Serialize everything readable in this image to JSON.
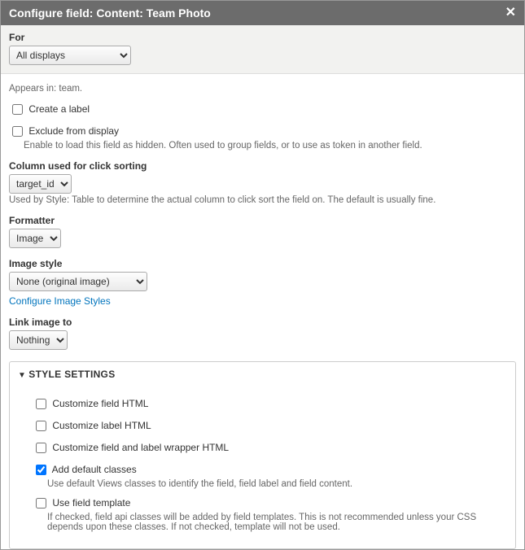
{
  "header": {
    "title": "Configure field: Content: Team Photo"
  },
  "for": {
    "label": "For",
    "value": "All displays"
  },
  "appears_in": "Appears in: team.",
  "create_label": {
    "label": "Create a label",
    "checked": false
  },
  "exclude": {
    "label": "Exclude from display",
    "checked": false,
    "help": "Enable to load this field as hidden. Often used to group fields, or to use as token in another field."
  },
  "click_sort": {
    "label": "Column used for click sorting",
    "value": "target_id",
    "help": "Used by Style: Table to determine the actual column to click sort the field on. The default is usually fine."
  },
  "formatter": {
    "label": "Formatter",
    "value": "Image"
  },
  "image_style": {
    "label": "Image style",
    "value": "None (original image)",
    "configure_link": "Configure Image Styles"
  },
  "link_to": {
    "label": "Link image to",
    "value": "Nothing"
  },
  "style_settings": {
    "title": "STYLE SETTINGS",
    "customize_field_html": {
      "label": "Customize field HTML",
      "checked": false
    },
    "customize_label_html": {
      "label": "Customize label HTML",
      "checked": false
    },
    "customize_wrapper_html": {
      "label": "Customize field and label wrapper HTML",
      "checked": false
    },
    "default_classes": {
      "label": "Add default classes",
      "checked": true,
      "help": "Use default Views classes to identify the field, field label and field content."
    },
    "field_template": {
      "label": "Use field template",
      "checked": false,
      "help": "If checked, field api classes will be added by field templates. This is not recommended unless your CSS depends upon these classes. If not checked, template will not be used."
    }
  }
}
